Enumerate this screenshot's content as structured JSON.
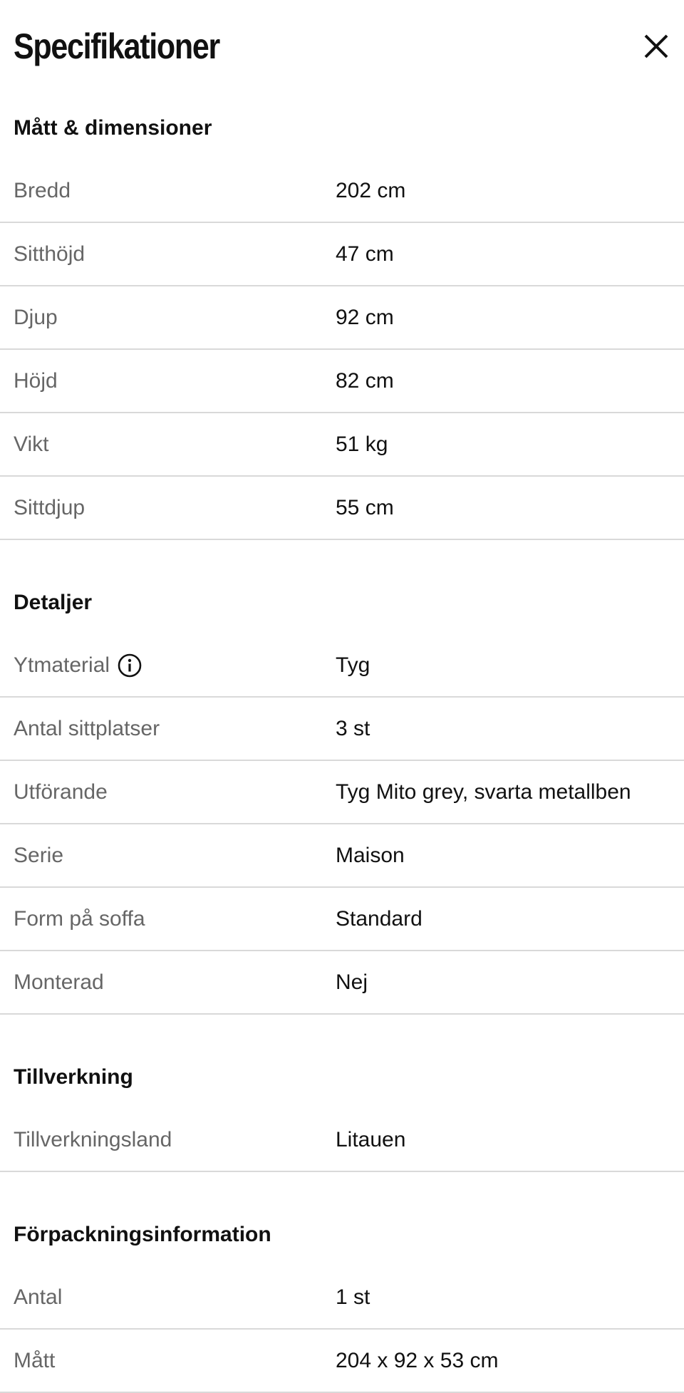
{
  "header": {
    "title": "Specifikationer",
    "close_icon": "close-icon"
  },
  "sections": [
    {
      "title": "Mått & dimensioner",
      "rows": [
        {
          "label": "Bredd",
          "value": "202 cm"
        },
        {
          "label": "Sitthöjd",
          "value": "47 cm"
        },
        {
          "label": "Djup",
          "value": "92 cm"
        },
        {
          "label": "Höjd",
          "value": "82 cm"
        },
        {
          "label": "Vikt",
          "value": "51 kg"
        },
        {
          "label": "Sittdjup",
          "value": "55 cm"
        }
      ]
    },
    {
      "title": "Detaljer",
      "rows": [
        {
          "label": "Ytmaterial",
          "value": "Tyg",
          "icon": "info-icon"
        },
        {
          "label": "Antal sittplatser",
          "value": "3 st"
        },
        {
          "label": "Utförande",
          "value": "Tyg Mito grey, svarta metallben"
        },
        {
          "label": "Serie",
          "value": "Maison"
        },
        {
          "label": "Form på soffa",
          "value": "Standard"
        },
        {
          "label": "Monterad",
          "value": "Nej"
        }
      ]
    },
    {
      "title": "Tillverkning",
      "rows": [
        {
          "label": "Tillverkningsland",
          "value": "Litauen"
        }
      ]
    },
    {
      "title": "Förpackningsinformation",
      "rows": [
        {
          "label": "Antal",
          "value": "1 st"
        },
        {
          "label": "Mått",
          "value": "204 x 92 x 53 cm"
        }
      ]
    }
  ],
  "colors": {
    "text": "#111111",
    "label": "#666666",
    "divider": "#d9d9d9",
    "background": "#ffffff"
  }
}
